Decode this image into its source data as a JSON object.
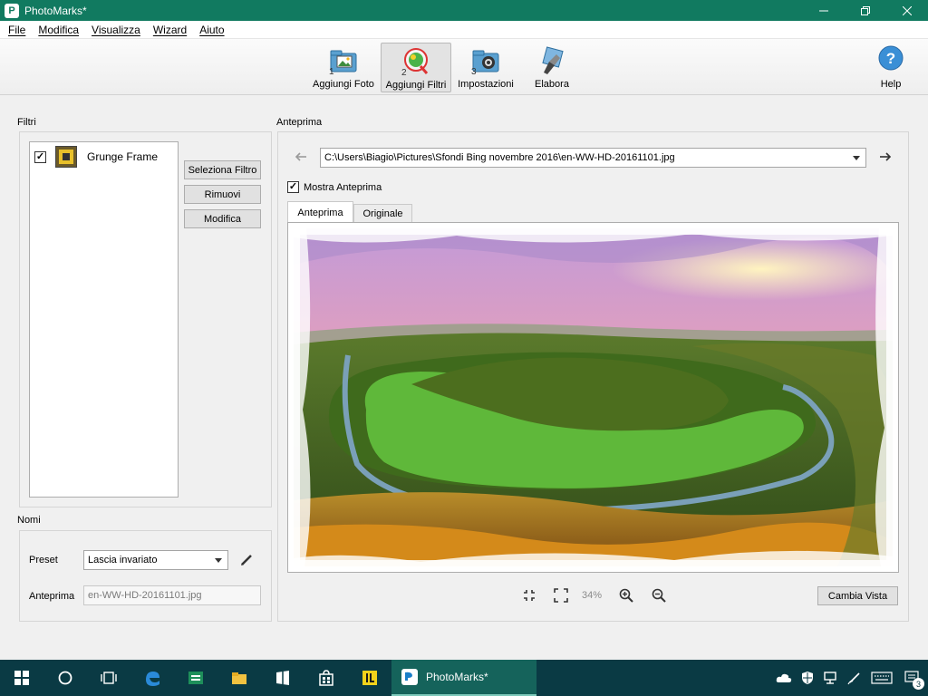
{
  "window": {
    "title": "PhotoMarks*"
  },
  "menu": [
    "File",
    "Modifica",
    "Visualizza",
    "Wizard",
    "Aiuto"
  ],
  "toolbar": {
    "steps": [
      {
        "label": "Aggiungi Foto",
        "number": "1",
        "icon": "photos-folder-icon"
      },
      {
        "label": "Aggiungi Filtri",
        "number": "2",
        "icon": "filter-icon",
        "active": true
      },
      {
        "label": "Impostazioni",
        "number": "3",
        "icon": "settings-camera-icon"
      },
      {
        "label": "Elabora",
        "number": "",
        "icon": "process-icon"
      }
    ],
    "help_label": "Help",
    "help_glyph": "?"
  },
  "filters": {
    "section_label": "Filtri",
    "items": [
      {
        "name": "Grunge Frame",
        "checked": true,
        "check_glyph": "✓"
      }
    ],
    "buttons": {
      "select": "Seleziona Filtro",
      "remove": "Rimuovi",
      "edit": "Modifica"
    }
  },
  "names": {
    "section_label": "Nomi",
    "preset_label": "Preset",
    "preset_value": "Lascia invariato",
    "preview_label": "Anteprima",
    "preview_value": "en-WW-HD-20161101.jpg"
  },
  "preview": {
    "section_label": "Anteprima",
    "path": "C:\\Users\\Biagio\\Pictures\\Sfondi Bing novembre 2016\\en-WW-HD-20161101.jpg",
    "show_preview_label": "Mostra Anteprima",
    "show_preview_checked": true,
    "show_preview_glyph": "✓",
    "tabs": [
      "Anteprima",
      "Originale"
    ],
    "zoom": "34%",
    "change_view": "Cambia Vista",
    "back_glyph": "🡐",
    "forward_glyph": "🡒"
  },
  "taskbar": {
    "active_app": "PhotoMarks*",
    "notification_count": "3"
  },
  "colors": {
    "titlebar": "#117a60",
    "taskbar": "#0a3a44",
    "taskbar_active": "#15635b"
  }
}
